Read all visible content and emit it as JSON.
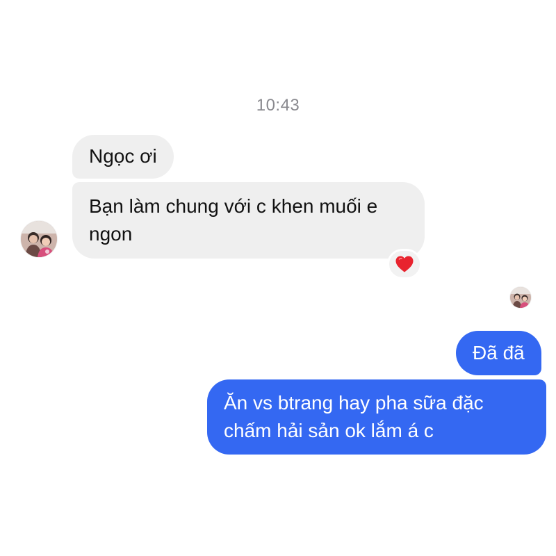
{
  "timestamp": "10:43",
  "messages": [
    {
      "direction": "incoming",
      "text": "Ngọc ơi"
    },
    {
      "direction": "incoming",
      "text": "Bạn làm chung với c khen muối e ngon"
    },
    {
      "direction": "outgoing",
      "text": "Đã đã"
    },
    {
      "direction": "outgoing",
      "text": "Ăn vs btrang hay pha sữa đặc chấm hải sản ok lắm á c"
    }
  ],
  "reaction": {
    "emoji": "❤️",
    "icon": "heart-icon",
    "color": "#e8232e"
  },
  "colors": {
    "incoming_bubble": "#efefef",
    "outgoing_bubble": "#3468f2",
    "timestamp": "#8a8a8f"
  }
}
